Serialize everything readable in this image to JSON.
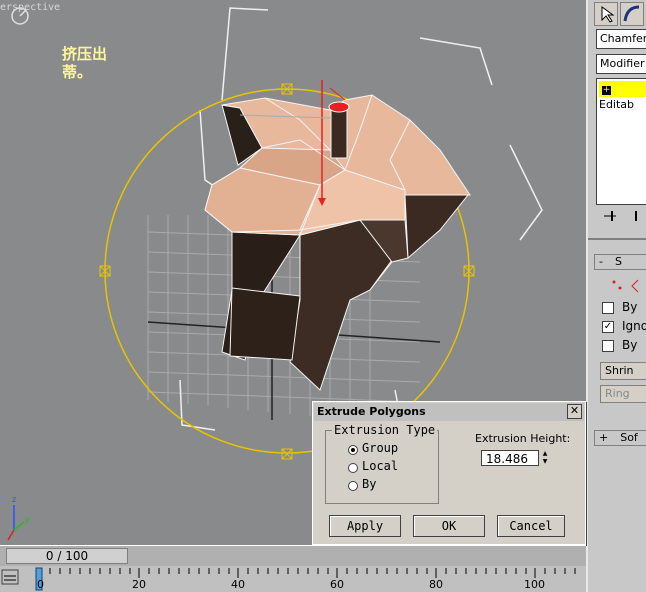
{
  "viewport": {
    "label": "erspective",
    "annotation": "挤压出\n 蒂。"
  },
  "right_panel": {
    "name_field": "ChamferC",
    "modifier_list": "Modifier Li",
    "stack_item": "Editab",
    "rollout_selection": "S",
    "checkboxes": [
      {
        "label": "By",
        "checked": false
      },
      {
        "label": "Igno",
        "checked": true
      },
      {
        "label": "By",
        "checked": false
      }
    ],
    "buttons": [
      "Shrin",
      "Ring"
    ],
    "rollout_soft": "Sof"
  },
  "dialog": {
    "title": "Extrude Polygons",
    "group_title": "Extrusion Type",
    "options": [
      {
        "label": "Group",
        "selected": true
      },
      {
        "label": "Local",
        "selected": false
      },
      {
        "label": "By",
        "selected": false
      }
    ],
    "height_label": "Extrusion Height:",
    "height_value": "18.486",
    "apply_label": "Apply",
    "ok_label": "OK",
    "cancel_label": "Cancel"
  },
  "timeline": {
    "frame_display": "0 / 100",
    "ticks": [
      "0",
      "20",
      "40",
      "60",
      "80",
      "100"
    ]
  },
  "colors": {
    "viewport_bg": "#888a8c",
    "gizmo_yellow": "#e8c400",
    "mesh_top": "#e7b89c",
    "mesh_side": "#3a2a22",
    "selection_yellow": "#ffff00"
  }
}
